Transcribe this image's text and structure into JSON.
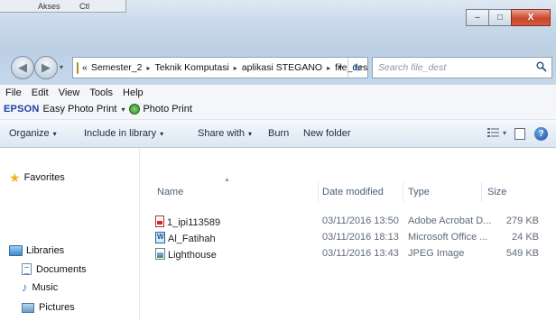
{
  "window": {
    "behind_tabs": [
      "Akses",
      "Ctl"
    ],
    "caption": {
      "minimize": "–",
      "maximize": "□",
      "close": "X"
    }
  },
  "address_bar": {
    "history_drop": "▾",
    "overflow": "«",
    "crumbs": [
      "Semester_2",
      "Teknik Komputasi",
      "aplikasi STEGANO",
      "file_dest"
    ],
    "separator": "▸",
    "dropdown": "▾",
    "refresh": "↻"
  },
  "search": {
    "placeholder": "Search file_dest"
  },
  "menu": {
    "items": [
      "File",
      "Edit",
      "View",
      "Tools",
      "Help"
    ]
  },
  "epson_bar": {
    "brand": "EPSON",
    "app": "Easy Photo Print",
    "drop": "▾",
    "photo_print": "Photo Print"
  },
  "command_bar": {
    "organize": "Organize",
    "include_in_library": "Include in library",
    "share_with": "Share with",
    "burn": "Burn",
    "new_folder": "New folder",
    "dd": "▾",
    "help": "?"
  },
  "nav_pane": {
    "favorites": "Favorites",
    "libraries": "Libraries",
    "documents": "Documents",
    "music": "Music",
    "pictures": "Pictures"
  },
  "file_list": {
    "columns": {
      "name": "Name",
      "date_modified": "Date modified",
      "type": "Type",
      "size": "Size"
    },
    "sort_indicator": "▲",
    "files": [
      {
        "name": "1_ipi113589",
        "date": "03/11/2016 13:50",
        "type": "Adobe Acrobat D...",
        "size": "279 KB",
        "icon": "pdf-file-icon"
      },
      {
        "name": "Al_Fatihah",
        "date": "03/11/2016 18:13",
        "type": "Microsoft Office ...",
        "size": "24 KB",
        "icon": "word-file-icon"
      },
      {
        "name": "Lighthouse",
        "date": "03/11/2016 13:43",
        "type": "JPEG Image",
        "size": "549 KB",
        "icon": "image-file-icon"
      }
    ]
  }
}
